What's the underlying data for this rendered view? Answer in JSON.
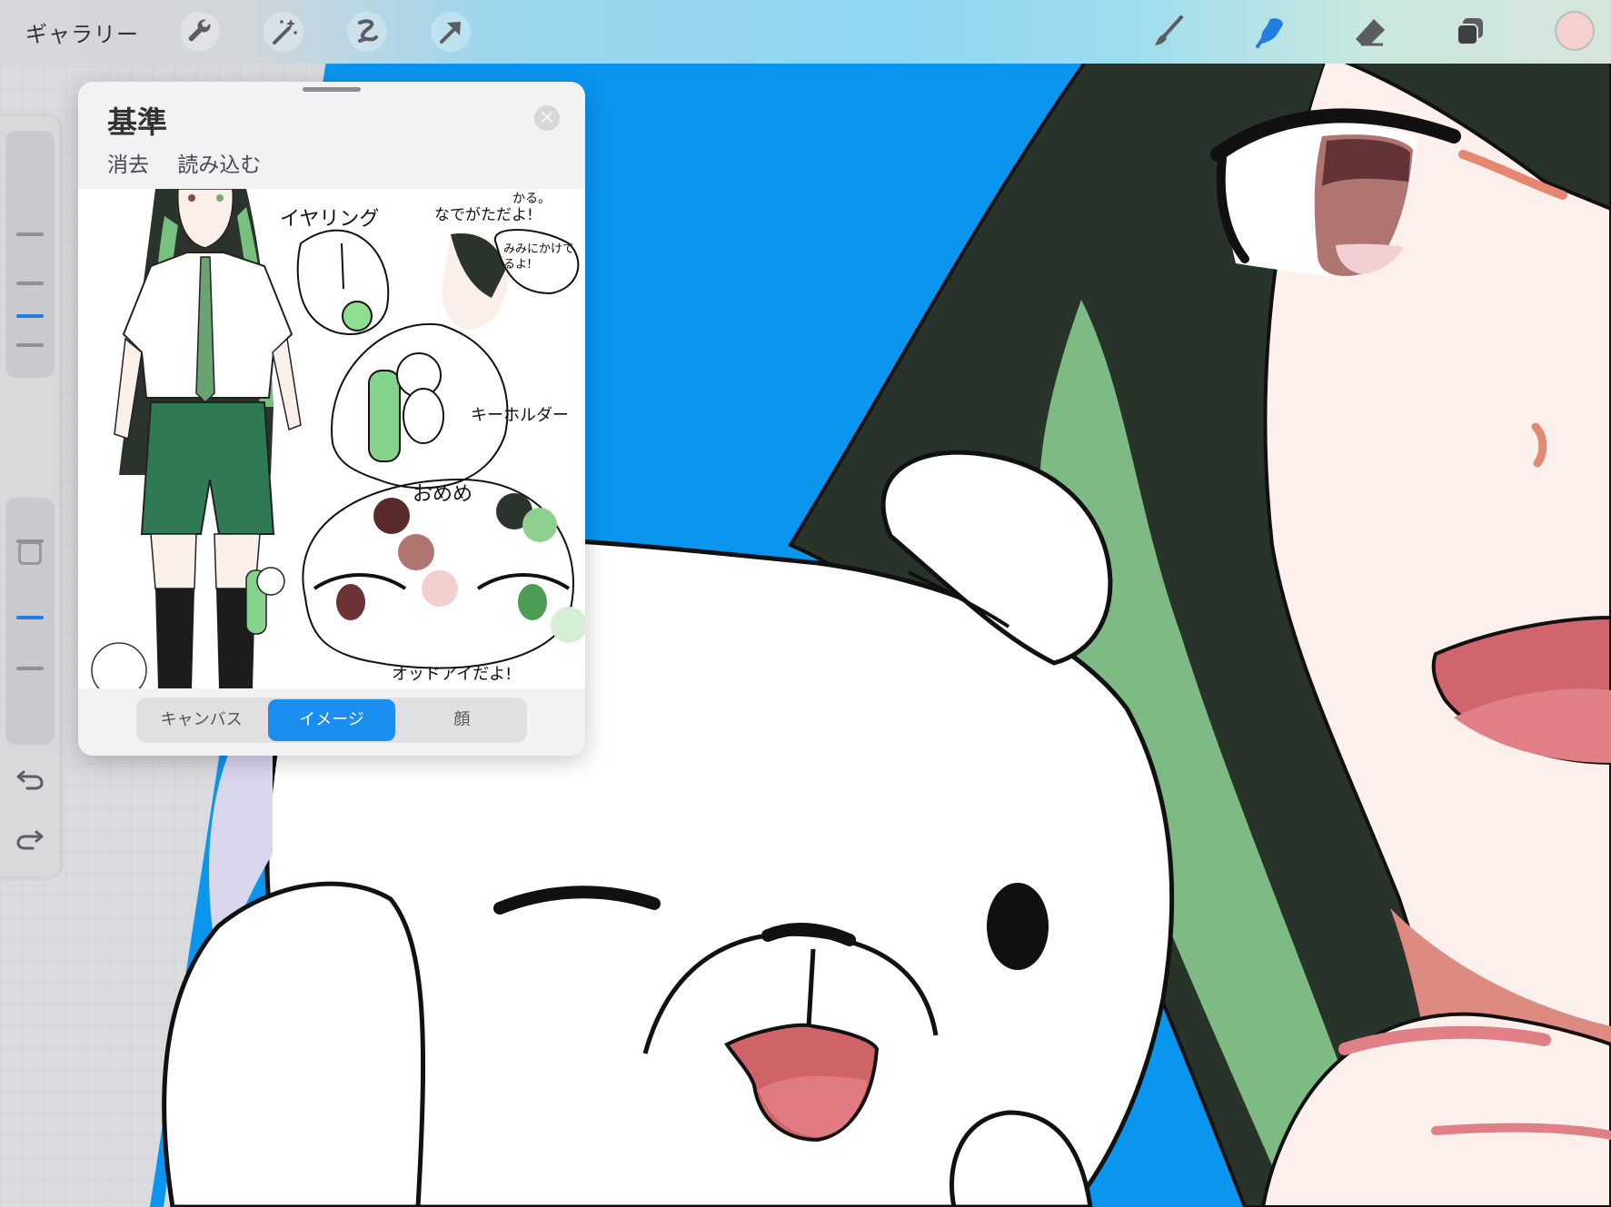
{
  "toolbar": {
    "gallery_label": "ギャラリー",
    "tools": [
      "wrench-icon",
      "magic-wand-icon",
      "selection-icon",
      "transform-arrow-icon",
      "brush-icon",
      "smudge-icon",
      "eraser-icon",
      "layers-icon"
    ],
    "active_tool": "smudge-icon",
    "accent_color": "#1f7ee0",
    "current_color": "#f6cfd0"
  },
  "sidebar": {
    "items": [
      "brush-size-slider",
      "opacity-slider",
      "modify-button",
      "undo-button",
      "redo-button"
    ]
  },
  "reference_panel": {
    "title": "基準",
    "actions": [
      "消去",
      "読み込む"
    ],
    "segments": [
      "キャンバス",
      "イメージ",
      "顔"
    ],
    "active_segment": "イメージ",
    "sheet_labels": {
      "earring": "イヤリング",
      "braid": "なでがただよ!",
      "ear_note": "みみにかけてるよ!",
      "keyholder": "キーホルダー",
      "eyes": "おめめ",
      "odd_eye": "オッドアイだよ!",
      "top_note": "かる。"
    }
  }
}
